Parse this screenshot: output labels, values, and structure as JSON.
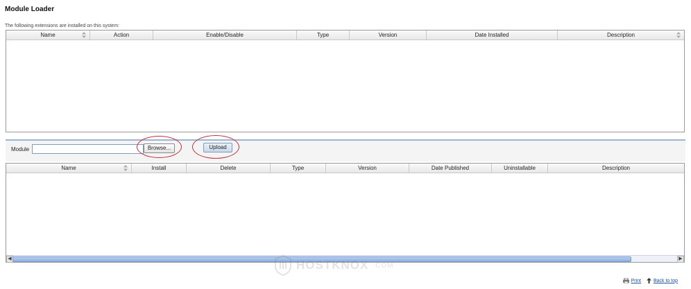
{
  "page": {
    "title": "Module Loader",
    "subtitle": "The following extensions are installed on this system:"
  },
  "installed_table": {
    "columns": [
      "Name",
      "Action",
      "Enable/Disable",
      "Type",
      "Version",
      "Date Installed",
      "Description"
    ],
    "rows": []
  },
  "upload": {
    "module_label": "Module",
    "module_value": "",
    "browse_label": "Browse...",
    "upload_label": "Upload"
  },
  "available_table": {
    "columns": [
      "Name",
      "Install",
      "Delete",
      "Type",
      "Version",
      "Date Published",
      "Uninstallable",
      "Description"
    ],
    "rows": []
  },
  "footer": {
    "print_label": "Print",
    "back_to_top_label": "Back to top"
  },
  "watermark": {
    "brand": "HOSTKNOX",
    "suffix": ".COM"
  },
  "colors": {
    "highlight": "#c0303a",
    "link": "#1b4fa3",
    "scroll_thumb": "#8fb0e2"
  }
}
